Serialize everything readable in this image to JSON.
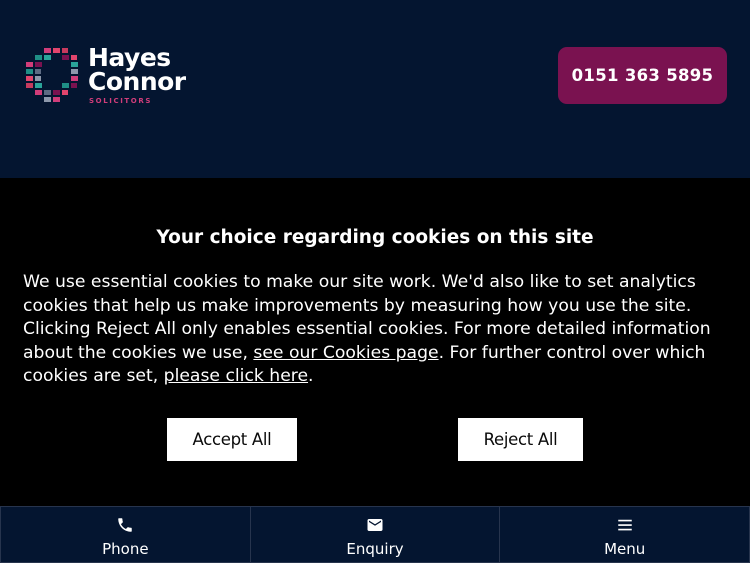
{
  "header": {
    "logo": {
      "name_line1": "Hayes",
      "name_line2": "Connor",
      "tagline": "SOLICITORS"
    },
    "phone_button": "0151 363 5895"
  },
  "cookie_banner": {
    "title": "Your choice regarding cookies on this site",
    "body_part1": "We use essential cookies to make our site work. We'd also like to set analytics cookies that help us make improvements by measuring how you use the site. Clicking Reject All only enables essential cookies. For more detailed information about the cookies we use, ",
    "cookies_page_link": "see our Cookies page",
    "body_part2": ". For further control over which cookies are set, ",
    "please_click_link": "please click here",
    "body_part3": ".",
    "accept_label": "Accept All",
    "reject_label": "Reject All"
  },
  "bottom_nav": {
    "items": [
      {
        "label": "Phone",
        "icon": "phone-icon"
      },
      {
        "label": "Enquiry",
        "icon": "envelope-icon"
      },
      {
        "label": "Menu",
        "icon": "hamburger-menu-icon"
      }
    ]
  },
  "colors": {
    "navy": "#041530",
    "brand_plum": "#7a1250",
    "banner_bg": "#000000",
    "accent_pink": "#d13d7a"
  }
}
